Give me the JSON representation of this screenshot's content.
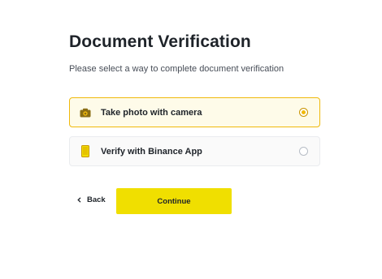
{
  "header": {
    "title": "Document Verification",
    "subtitle": "Please select a way to complete document verification"
  },
  "options": [
    {
      "label": "Take photo with camera",
      "icon": "camera-icon",
      "selected": true
    },
    {
      "label": "Verify with Binance App",
      "icon": "phone-icon",
      "selected": false
    }
  ],
  "actions": {
    "back_label": "Back",
    "continue_label": "Continue"
  },
  "colors": {
    "accent": "#f0df00",
    "selected_border": "#f0b90b",
    "text": "#1e2329"
  }
}
